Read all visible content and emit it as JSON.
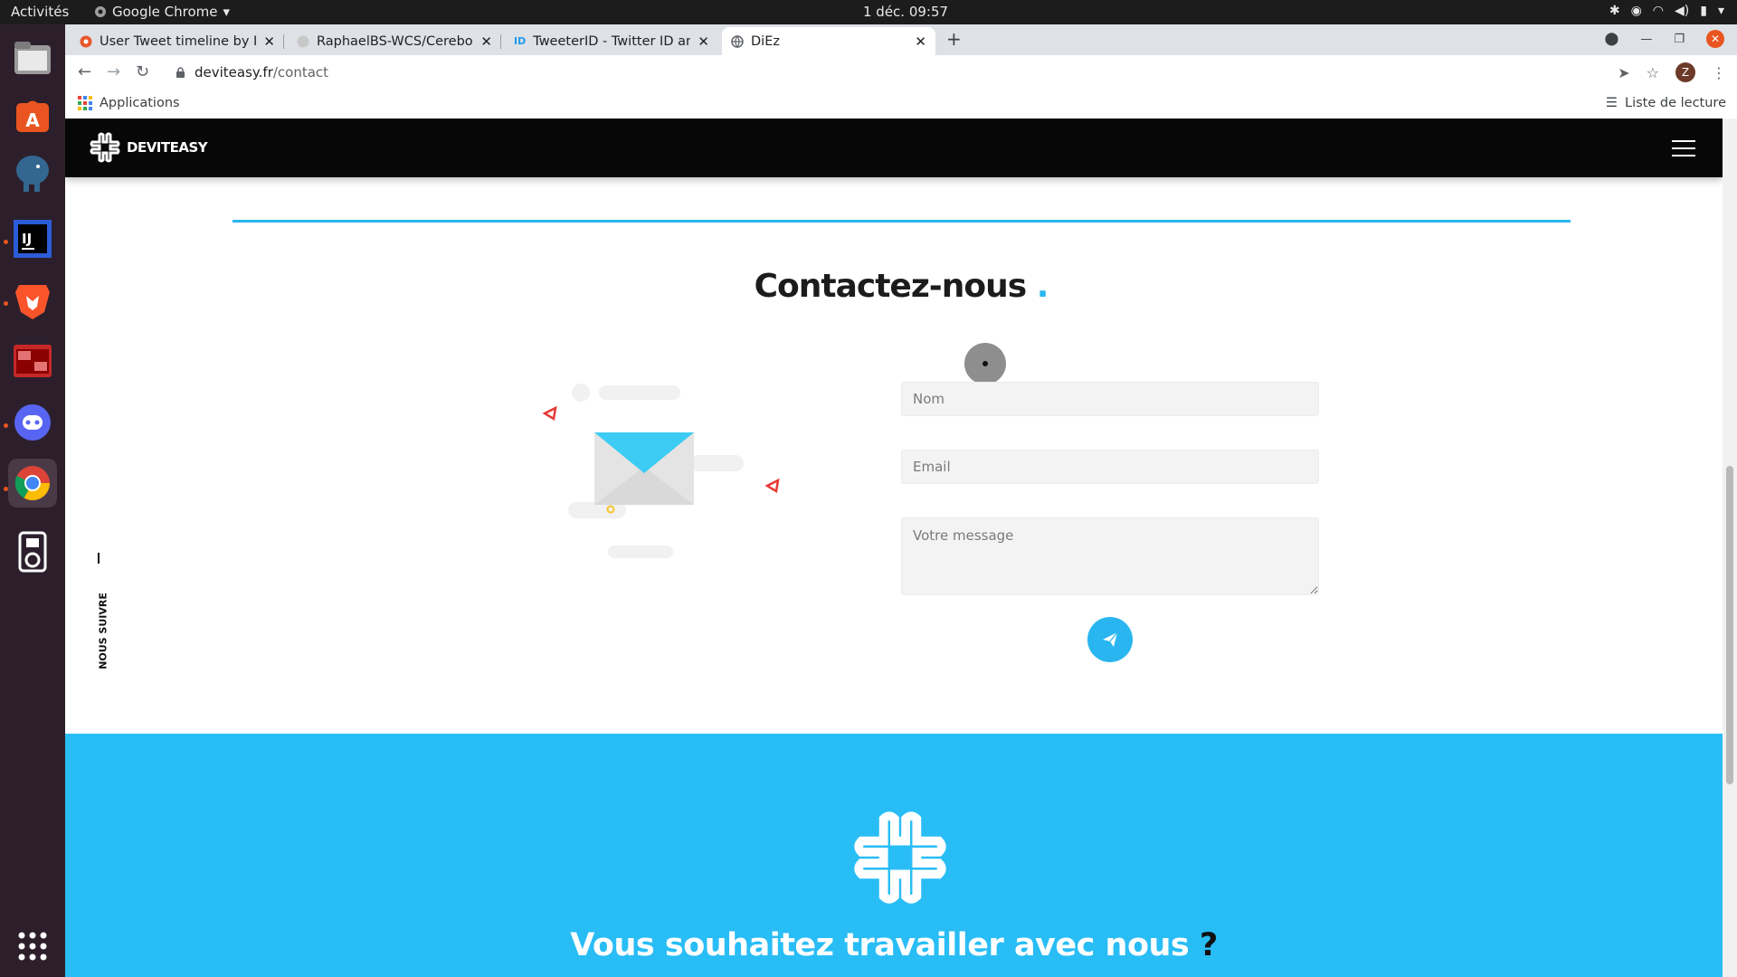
{
  "os": {
    "activities": "Activités",
    "app_name": "Google Chrome",
    "clock": "1 déc.  09:57"
  },
  "browser": {
    "tabs": [
      {
        "title": "User Tweet timeline by ID",
        "icon": "orange-circle-icon"
      },
      {
        "title": "RaphaelBS-WCS/Cerebook",
        "icon": "github-icon"
      },
      {
        "title": "TweeterID - Twitter ID and",
        "icon": "id-icon"
      },
      {
        "title": "DiEz",
        "icon": "globe-icon"
      }
    ],
    "url_domain": "deviteasy.fr",
    "url_path": "/contact",
    "profile_initial": "Z",
    "bookmarks_apps": "Applications",
    "reading_list": "Liste de lecture"
  },
  "site": {
    "logo_text": "DEVITEASY",
    "contact_title": "Contactez-nous",
    "form": {
      "name_placeholder": "Nom",
      "email_placeholder": "Email",
      "message_placeholder": "Votre message"
    },
    "follow_label": "NOUS SUIVRE",
    "cta_title": "Vous souhaitez travailler avec nous",
    "cta_question_mark": "?"
  },
  "colors": {
    "accent": "#29b6f0",
    "cta_bg": "#29bdf6",
    "nav_bg": "#070707",
    "dock_bg": "#2c1f2b"
  }
}
